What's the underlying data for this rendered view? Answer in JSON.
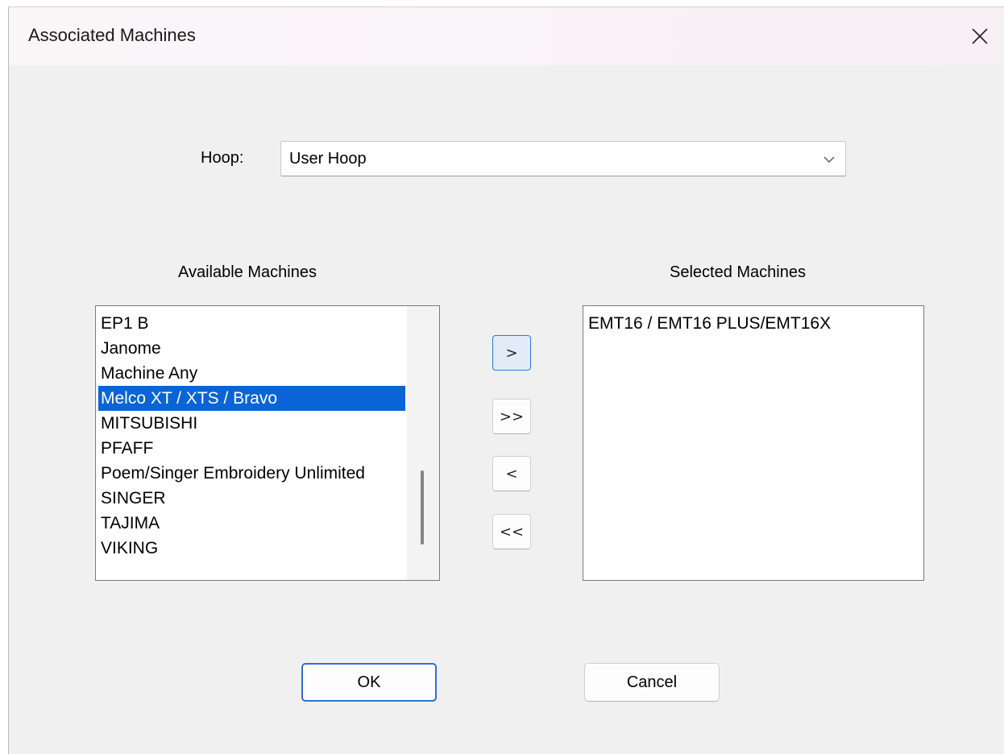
{
  "dialog": {
    "title": "Associated Machines",
    "close_icon": "close-icon"
  },
  "hoop": {
    "label": "Hoop:",
    "value": "User Hoop"
  },
  "available": {
    "heading": "Available Machines",
    "items": [
      "EP1 B",
      "Janome",
      "Machine Any",
      "Melco XT / XTS / Bravo",
      "MITSUBISHI",
      "PFAFF",
      "Poem/Singer Embroidery Unlimited",
      "SINGER",
      "TAJIMA",
      "VIKING"
    ],
    "selected_item": "Melco XT / XTS / Bravo"
  },
  "selected": {
    "heading": "Selected Machines",
    "items": [
      "EMT16 / EMT16 PLUS/EMT16X"
    ]
  },
  "move_buttons": {
    "add": ">",
    "add_all": ">>",
    "remove": "<",
    "remove_all": "<<"
  },
  "buttons": {
    "ok": "OK",
    "cancel": "Cancel"
  },
  "colors": {
    "selection": "#0a64d6",
    "focus_border": "#2f78d4"
  }
}
